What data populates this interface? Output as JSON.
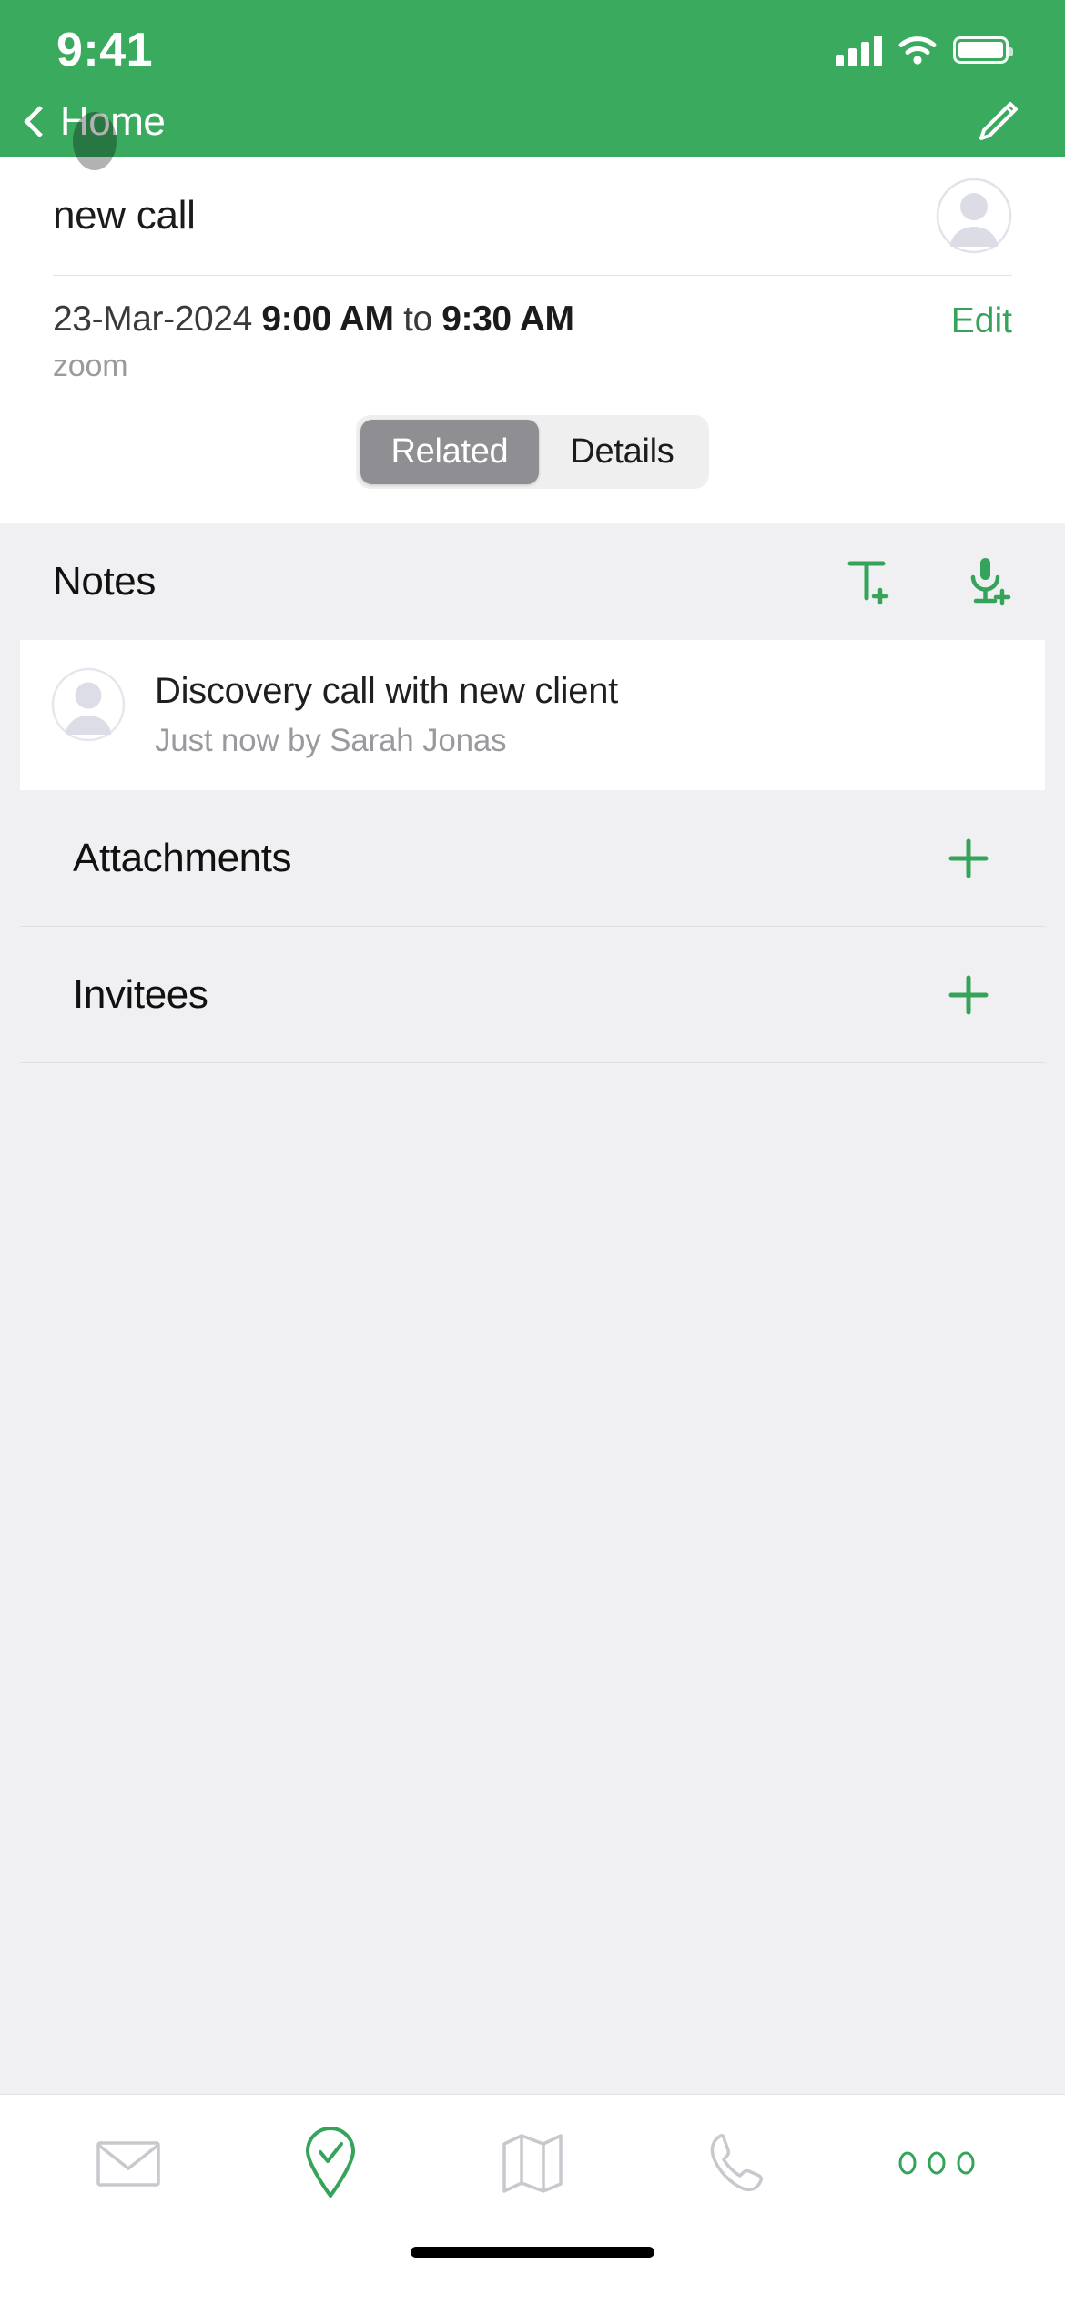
{
  "theme": {
    "brand_green": "#3AAA5E",
    "accent_green": "#35A45A",
    "body_gray": "#F0F0F2",
    "segment_active": "#8E8E93"
  },
  "status_bar": {
    "time": "9:41",
    "cellular_icon": "signal-bars-icon",
    "wifi_icon": "wifi-icon",
    "battery_icon": "battery-icon"
  },
  "navbar": {
    "back_icon": "chevron-left-icon",
    "back_label": "Home",
    "edit_icon": "pencil-icon",
    "touch_indicator": "touch-point-indicator"
  },
  "detail": {
    "title": "new call",
    "avatar_icon": "person-avatar-icon",
    "date": "23-Mar-2024",
    "start_time": "9:00 AM",
    "separator": "to",
    "end_time": "9:30 AM",
    "location": "zoom",
    "edit_label": "Edit"
  },
  "segmented_control": {
    "selected": "Related",
    "options": [
      {
        "label": "Related",
        "active": true
      },
      {
        "label": "Details",
        "active": false
      }
    ]
  },
  "notes_section": {
    "title": "Notes",
    "add_text_note_icon": "text-plus-icon",
    "add_voice_note_icon": "microphone-plus-icon",
    "items": [
      {
        "avatar_icon": "person-avatar-icon",
        "text": "Discovery call with new client",
        "meta": "Just now by Sarah Jonas"
      }
    ]
  },
  "sections": [
    {
      "label": "Attachments",
      "add_icon": "plus-icon"
    },
    {
      "label": "Invitees",
      "add_icon": "plus-icon"
    }
  ],
  "tab_bar": {
    "items": [
      {
        "name": "mail",
        "icon": "envelope-icon",
        "active": false
      },
      {
        "name": "activities",
        "icon": "location-pin-check-icon",
        "active": true
      },
      {
        "name": "map",
        "icon": "map-icon",
        "active": false
      },
      {
        "name": "calls",
        "icon": "phone-icon",
        "active": false
      },
      {
        "name": "more",
        "icon": "more-dots-icon",
        "active": true
      }
    ]
  },
  "home_indicator": "home-indicator-bar"
}
